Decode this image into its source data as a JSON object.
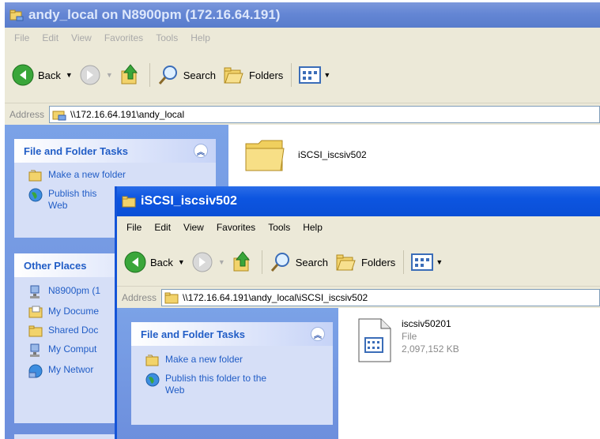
{
  "back_window": {
    "title": "andy_local on N8900pm (172.16.64.191)",
    "menu": [
      "File",
      "Edit",
      "View",
      "Favorites",
      "Tools",
      "Help"
    ],
    "toolbar": {
      "back": "Back",
      "search": "Search",
      "folders": "Folders"
    },
    "address": {
      "label": "Address",
      "value": "\\\\172.16.64.191\\andy_local"
    },
    "file_folder_tasks": {
      "title": "File and Folder Tasks",
      "items": [
        "Make a new folder",
        "Publish this",
        "Web"
      ]
    },
    "other_places": {
      "title": "Other Places",
      "items": [
        "N8900pm (1",
        "My Docume",
        "Shared Doc",
        "My Comput",
        "My Networ"
      ]
    },
    "content": {
      "folder_name": "iSCSI_iscsiv502"
    }
  },
  "front_window": {
    "title": "iSCSI_iscsiv502",
    "menu": [
      "File",
      "Edit",
      "View",
      "Favorites",
      "Tools",
      "Help"
    ],
    "toolbar": {
      "back": "Back",
      "search": "Search",
      "folders": "Folders"
    },
    "address": {
      "label": "Address",
      "value": "\\\\172.16.64.191\\andy_local\\iSCSI_iscsiv502"
    },
    "file_folder_tasks": {
      "title": "File and Folder Tasks",
      "items": [
        "Make a new folder",
        "Publish this folder to the",
        "Web"
      ]
    },
    "file": {
      "name": "iscsiv50201",
      "type": "File",
      "size": "2,097,152 KB"
    }
  },
  "colors": {
    "xp_blue_title": "#0a4fd6",
    "taskpane_blue": "#6d8fdd",
    "task_link": "#215dc6",
    "chrome": "#ece9d8"
  }
}
